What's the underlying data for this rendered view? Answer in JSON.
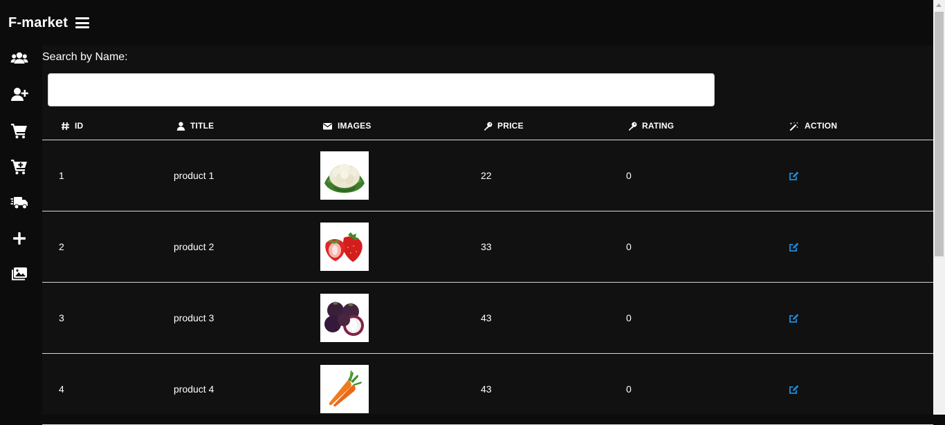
{
  "app": {
    "title": "F-market"
  },
  "sidebar": {
    "items": [
      {
        "name": "users-icon"
      },
      {
        "name": "add-user-icon"
      },
      {
        "name": "cart-icon"
      },
      {
        "name": "cart-plus-icon"
      },
      {
        "name": "delivery-truck-icon"
      },
      {
        "name": "plus-icon"
      },
      {
        "name": "images-icon"
      }
    ]
  },
  "search": {
    "label": "Search by Name:",
    "value": "",
    "placeholder": ""
  },
  "table": {
    "headers": {
      "id": "ID",
      "title": "TITLE",
      "images": "IMAGES",
      "price": "PRICE",
      "rating": "RATING",
      "action": "ACTION"
    },
    "rows": [
      {
        "id": "1",
        "title": "product 1",
        "image": "cauliflower",
        "price": "22",
        "rating": "0"
      },
      {
        "id": "2",
        "title": "product 2",
        "image": "strawberries",
        "price": "33",
        "rating": "0"
      },
      {
        "id": "3",
        "title": "product 3",
        "image": "mangosteen",
        "price": "43",
        "rating": "0"
      },
      {
        "id": "4",
        "title": "product 4",
        "image": "carrots",
        "price": "43",
        "rating": "0"
      }
    ]
  },
  "colors": {
    "accent": "#1e8fe0",
    "background": "#0c0c0c",
    "panel": "#111111"
  }
}
